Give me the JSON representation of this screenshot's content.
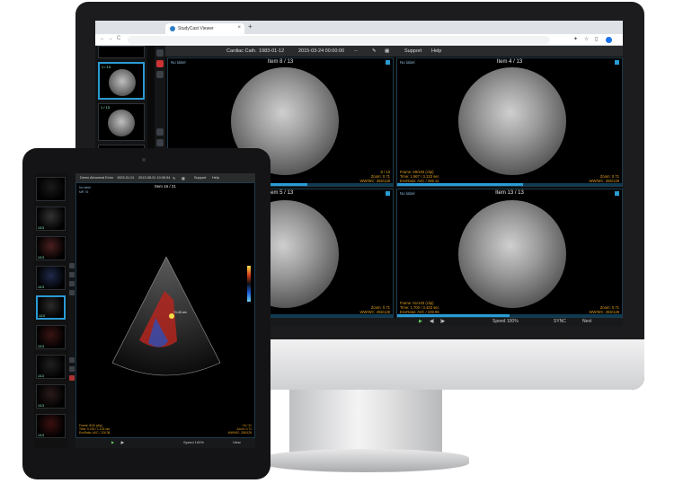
{
  "browser": {
    "tab_title": "StudyCast Viewer",
    "tab_close": "×",
    "new_tab": "+",
    "nav_back": "←",
    "nav_forward": "→",
    "nav_reload": "C"
  },
  "viewer": {
    "header": {
      "study_name": "Cardiac Cath.",
      "birth_date": "1983-01-12",
      "study_datetime": "2015-03-24 00:00:00",
      "separator": "--",
      "support": "Support",
      "help": "Help"
    },
    "thumbs": [
      {
        "label": ""
      },
      {
        "label": "1 / 13"
      },
      {
        "label": "1 / 13"
      },
      {
        "label": ""
      }
    ],
    "panes": [
      {
        "no_label": "No label",
        "item": "Item 8 / 13",
        "bottom_right": "8 / 13\nZoom: 0.71\nWW/WC: 255/128",
        "bottom_left": "",
        "progress": 0.62
      },
      {
        "no_label": "No label",
        "item": "Item 4 / 13",
        "bottom_right": "Zoom: 0.71\nWW/WC: 255/128",
        "bottom_left": "Frame: 59/104 (clip)\nTime: 1.967 / 3.133 sec\nEnvRatio: AVC / 255.11",
        "progress": 0.56
      },
      {
        "no_label": "No label",
        "item": "Item 5 / 13",
        "bottom_right": "Zoom: 0.71\nWW/WC: 255/128",
        "bottom_left": "",
        "progress": 0.0
      },
      {
        "no_label": "No label",
        "item": "Item 13 / 13",
        "bottom_right": "Zoom: 0.71\nWW/WC: 255/128",
        "bottom_left": "Frame: 51/103 (clip)\nTime: 1.700 / 3.433 sec\nEnvRatio: AVC / 249.95",
        "progress": 0.5
      }
    ],
    "player": {
      "speed": "Speed 100%",
      "sync": "SYNC",
      "next": "Next",
      "view_label": "View"
    }
  },
  "tablet": {
    "header": {
      "study_name": "Demo Abnormal Echo",
      "date1": "1923-01-01",
      "date2": "2013-08-01 10:06:34",
      "support": "Support",
      "help": "Help"
    },
    "thumb_labels": [
      "",
      "1/13",
      "1/13",
      "1/13",
      "1/13",
      "1/13",
      "1/13",
      "1/13",
      "1/13"
    ],
    "view": {
      "item": "Item 16 / 21",
      "no_label": "No label\nMR 76",
      "bottom_left": "Frame: 8/40 (clip)\nTime: 0.233 / 1.133 sec\nEnvRatio: AVC / 126.38",
      "bottom_right": "16 / 21\nZoom: 0.71\nWW/WC: 255/128",
      "marker": "+1.43 cm"
    },
    "player": {
      "speed": "Speed 100%",
      "view": "View"
    }
  },
  "colors": {
    "accent": "#2a9bd4",
    "overlay_text": "#e0a020",
    "label_text": "#8ab4d4"
  }
}
